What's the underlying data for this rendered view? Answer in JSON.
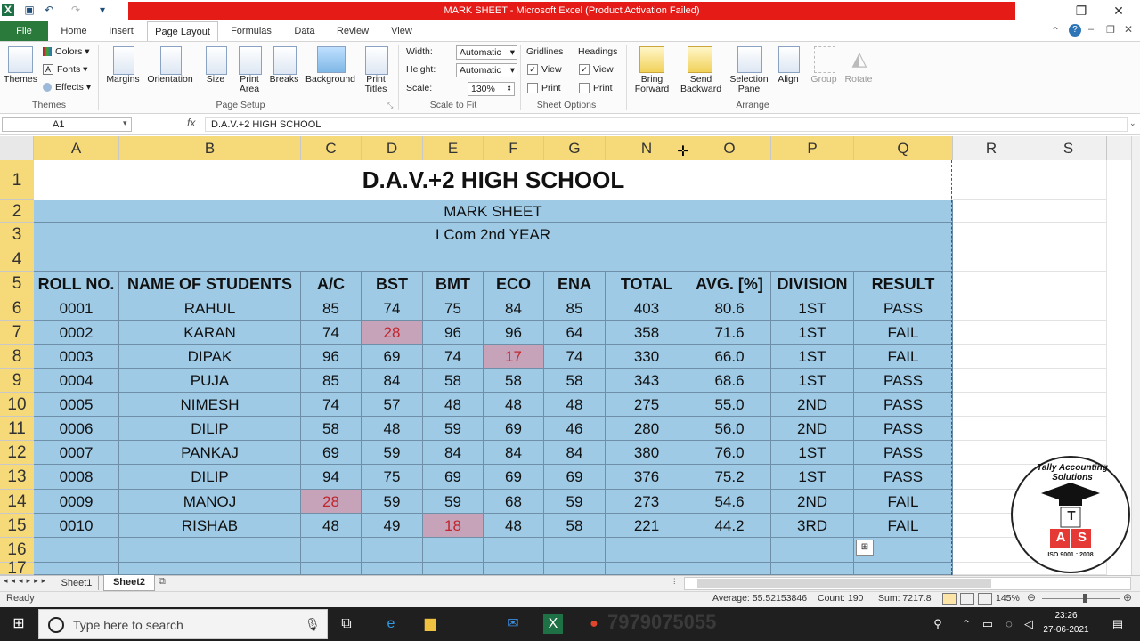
{
  "window": {
    "title": "MARK SHEET  -  Microsoft Excel (Product Activation Failed)",
    "controls": [
      "–",
      "❐",
      "✕"
    ]
  },
  "ribbon": {
    "tabs": [
      "File",
      "Home",
      "Insert",
      "Page Layout",
      "Formulas",
      "Data",
      "Review",
      "View"
    ],
    "active_tab": "Page Layout",
    "groups": {
      "themes": {
        "label": "Themes",
        "themes_btn": "Themes",
        "colors": "Colors",
        "fonts": "Fonts",
        "effects": "Effects"
      },
      "page_setup": {
        "label": "Page Setup",
        "margins": "Margins",
        "orientation": "Orientation",
        "size": "Size",
        "print_area": "Print Area",
        "breaks": "Breaks",
        "background": "Background",
        "print_titles": "Print Titles"
      },
      "scale_to_fit": {
        "label": "Scale to Fit",
        "width_label": "Width:",
        "width_value": "Automatic",
        "height_label": "Height:",
        "height_value": "Automatic",
        "scale_label": "Scale:",
        "scale_value": "130%"
      },
      "sheet_options": {
        "label": "Sheet Options",
        "gridlines": "Gridlines",
        "headings": "Headings",
        "view": "View",
        "print": "Print"
      },
      "arrange": {
        "label": "Arrange",
        "bring_forward": "Bring Forward",
        "send_backward": "Send Backward",
        "selection_pane": "Selection Pane",
        "align": "Align",
        "group": "Group",
        "rotate": "Rotate"
      }
    }
  },
  "formula_bar": {
    "name_box": "A1",
    "fx": "fx",
    "content": "D.A.V.+2 HIGH SCHOOL"
  },
  "grid": {
    "columns": [
      "A",
      "B",
      "C",
      "D",
      "E",
      "F",
      "G",
      "N",
      "O",
      "P",
      "Q",
      "R",
      "S"
    ],
    "rows": [
      "1",
      "2",
      "3",
      "4",
      "5",
      "6",
      "7",
      "8",
      "9",
      "10",
      "11",
      "12",
      "13",
      "14",
      "15",
      "16",
      "17"
    ],
    "title": "D.A.V.+2 HIGH SCHOOL",
    "subtitle1": "MARK SHEET",
    "subtitle2": "I Com 2nd YEAR",
    "headers": [
      "ROLL NO.",
      "NAME OF STUDENTS",
      "A/C",
      "BST",
      "BMT",
      "ECO",
      "ENA",
      "TOTAL",
      "AVG. [%]",
      "DIVISION",
      "RESULT"
    ],
    "records": [
      [
        "0001",
        "RAHUL",
        "85",
        "74",
        "75",
        "84",
        "85",
        "403",
        "80.6",
        "1ST",
        "PASS"
      ],
      [
        "0002",
        "KARAN",
        "74",
        "28",
        "96",
        "96",
        "64",
        "358",
        "71.6",
        "1ST",
        "FAIL"
      ],
      [
        "0003",
        "DIPAK",
        "96",
        "69",
        "74",
        "17",
        "74",
        "330",
        "66.0",
        "1ST",
        "FAIL"
      ],
      [
        "0004",
        "PUJA",
        "85",
        "84",
        "58",
        "58",
        "58",
        "343",
        "68.6",
        "1ST",
        "PASS"
      ],
      [
        "0005",
        "NIMESH",
        "74",
        "57",
        "48",
        "48",
        "48",
        "275",
        "55.0",
        "2ND",
        "PASS"
      ],
      [
        "0006",
        "DILIP",
        "58",
        "48",
        "59",
        "69",
        "46",
        "280",
        "56.0",
        "2ND",
        "PASS"
      ],
      [
        "0007",
        "PANKAJ",
        "69",
        "59",
        "84",
        "84",
        "84",
        "380",
        "76.0",
        "1ST",
        "PASS"
      ],
      [
        "0008",
        "DILIP",
        "94",
        "75",
        "69",
        "69",
        "69",
        "376",
        "75.2",
        "1ST",
        "PASS"
      ],
      [
        "0009",
        "MANOJ",
        "28",
        "59",
        "59",
        "68",
        "59",
        "273",
        "54.6",
        "2ND",
        "FAIL"
      ],
      [
        "0010",
        "RISHAB",
        "48",
        "49",
        "18",
        "48",
        "58",
        "221",
        "44.2",
        "3RD",
        "FAIL"
      ]
    ],
    "failing_cells": [
      [
        1,
        3
      ],
      [
        2,
        5
      ],
      [
        8,
        2
      ],
      [
        9,
        4
      ]
    ]
  },
  "sheet_tabs": [
    "Sheet1",
    "Sheet2"
  ],
  "active_sheet": "Sheet2",
  "status": {
    "ready": "Ready",
    "average": "Average: 55.52153846",
    "count": "Count: 190",
    "sum": "Sum: 7217.8",
    "zoom": "145%"
  },
  "taskbar": {
    "search_placeholder": "Type here to search",
    "time": "23:26",
    "date": "27-06-2021",
    "overlay_text": "7979075055"
  },
  "logo": {
    "brand": "Tally Accounting Solutions",
    "letters": [
      "T",
      "A",
      "S"
    ],
    "iso": "ISO 9001 : 2008"
  },
  "colors": {
    "accent_red": "#e41b17",
    "file_green": "#2a7a3b",
    "cell_blue": "#9ecae6",
    "fail_red": "#c0262d",
    "header_yellow": "#f6d978"
  }
}
